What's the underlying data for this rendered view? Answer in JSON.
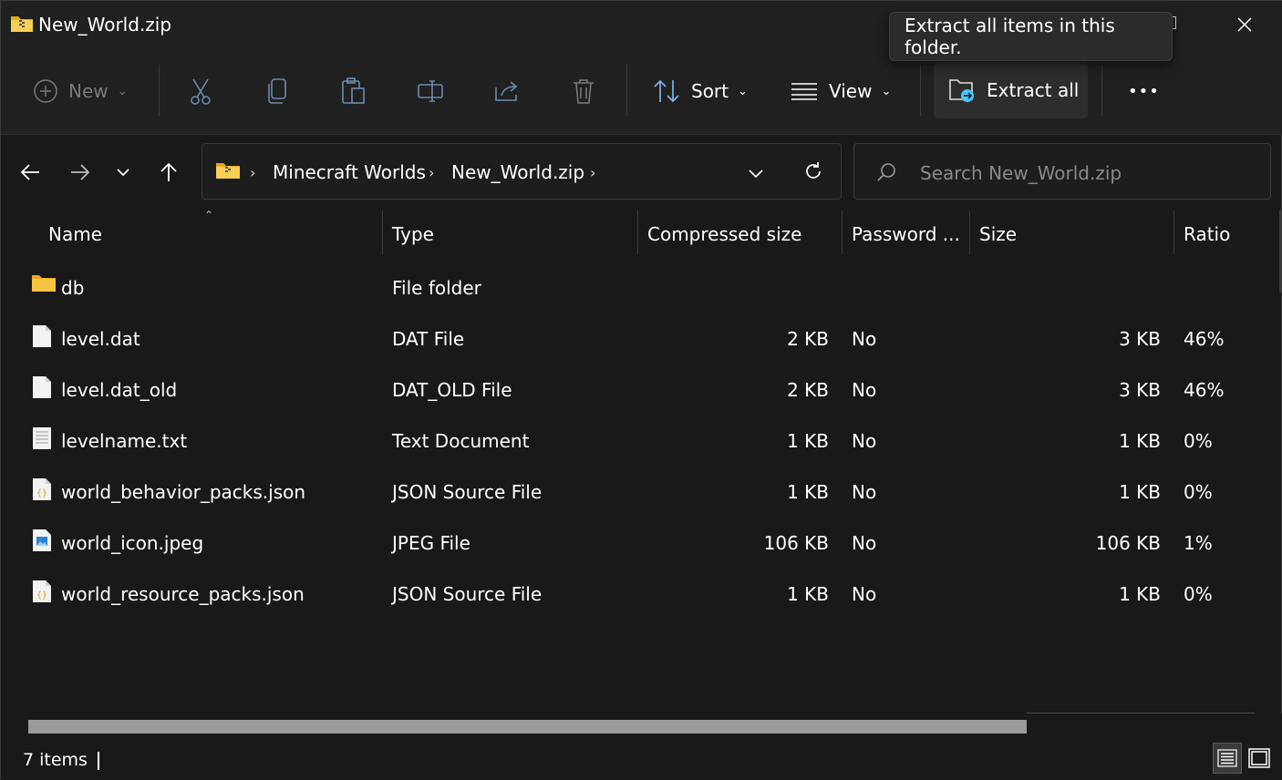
{
  "window": {
    "title": "New_World.zip"
  },
  "tooltip": {
    "text": "Extract all items in this folder."
  },
  "toolbar": {
    "new_label": "New",
    "sort_label": "Sort",
    "view_label": "View",
    "extract_label": "Extract all",
    "more_label": "•••"
  },
  "address": {
    "crumbs": [
      "Minecraft Worlds",
      "New_World.zip"
    ]
  },
  "search": {
    "placeholder": "Search New_World.zip"
  },
  "columns": {
    "name": "Name",
    "type": "Type",
    "compressed": "Compressed size",
    "password": "Password ...",
    "size": "Size",
    "ratio": "Ratio"
  },
  "files": [
    {
      "icon": "folder-icon",
      "name": "db",
      "type": "File folder",
      "compressed": "",
      "password": "",
      "size": "",
      "ratio": ""
    },
    {
      "icon": "file-icon",
      "name": "level.dat",
      "type": "DAT File",
      "compressed": "2 KB",
      "password": "No",
      "size": "3 KB",
      "ratio": "46%"
    },
    {
      "icon": "file-icon",
      "name": "level.dat_old",
      "type": "DAT_OLD File",
      "compressed": "2 KB",
      "password": "No",
      "size": "3 KB",
      "ratio": "46%"
    },
    {
      "icon": "text-file-icon",
      "name": "levelname.txt",
      "type": "Text Document",
      "compressed": "1 KB",
      "password": "No",
      "size": "1 KB",
      "ratio": "0%"
    },
    {
      "icon": "json-file-icon",
      "name": "world_behavior_packs.json",
      "type": "JSON Source File",
      "compressed": "1 KB",
      "password": "No",
      "size": "1 KB",
      "ratio": "0%"
    },
    {
      "icon": "image-file-icon",
      "name": "world_icon.jpeg",
      "type": "JPEG File",
      "compressed": "106 KB",
      "password": "No",
      "size": "106 KB",
      "ratio": "1%"
    },
    {
      "icon": "json-file-icon",
      "name": "world_resource_packs.json",
      "type": "JSON Source File",
      "compressed": "1 KB",
      "password": "No",
      "size": "1 KB",
      "ratio": "0%"
    }
  ],
  "status": {
    "items": "7 items"
  },
  "colors": {
    "background": "#191919",
    "toolbar": "#202020",
    "folder": "#f3c545",
    "accent": "#4cc2ff"
  }
}
